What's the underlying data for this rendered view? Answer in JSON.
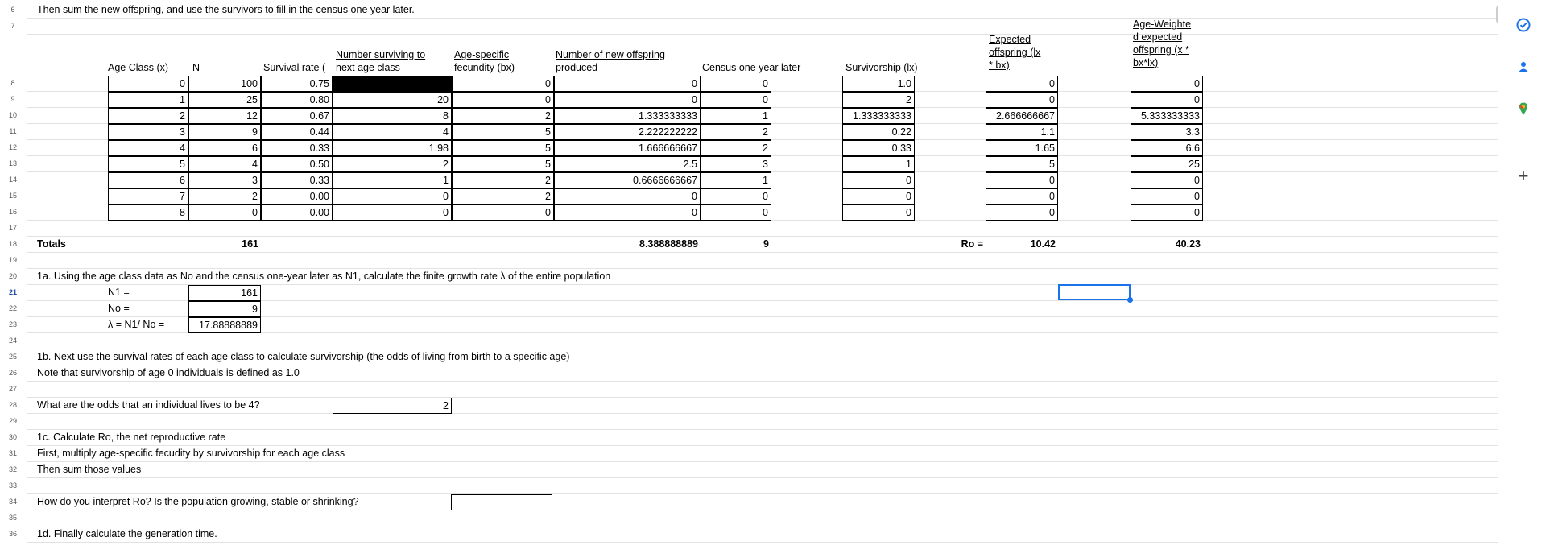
{
  "row_numbers": [
    "6",
    "7",
    "8",
    "9",
    "10",
    "11",
    "12",
    "13",
    "14",
    "15",
    "16",
    "17",
    "18",
    "19",
    "20",
    "21",
    "22",
    "23",
    "24",
    "25",
    "26",
    "27",
    "28",
    "29",
    "30",
    "31",
    "32",
    "33",
    "34",
    "35",
    "36"
  ],
  "selected_row": "21",
  "intro_text": "Then sum the new offspring, and use the survivors to fill in the census one year later.",
  "headers": {
    "age_class": "Age Class (x)",
    "n": "N",
    "survival_rate": "Survival rate (",
    "number_surviving": "Number surviving to\nnext age class",
    "fecundity": "Age-specific\nfecundity (bx)",
    "new_offspring": "Number of new offspring\nproduced",
    "census": "Census one year later",
    "survivorship": "Survivorship (lx)",
    "expected_offspring": "Expected\noffspring (lx\n* bx)",
    "age_weighted": "Age-Weighte\nd expected\noffspring (x *\nbx*lx)"
  },
  "table_rows": [
    {
      "age": "0",
      "n": "100",
      "survival": "0.75",
      "surviving": "",
      "fecundity": "0",
      "offspring": "0",
      "census": "0",
      "lx": "1.0",
      "exp": "0",
      "aw": "0"
    },
    {
      "age": "1",
      "n": "25",
      "survival": "0.80",
      "surviving": "20",
      "fecundity": "0",
      "offspring": "0",
      "census": "0",
      "lx": "2",
      "exp": "0",
      "aw": "0"
    },
    {
      "age": "2",
      "n": "12",
      "survival": "0.67",
      "surviving": "8",
      "fecundity": "2",
      "offspring": "1.333333333",
      "census": "1",
      "lx": "1.333333333",
      "exp": "2.666666667",
      "aw": "5.333333333"
    },
    {
      "age": "3",
      "n": "9",
      "survival": "0.44",
      "surviving": "4",
      "fecundity": "5",
      "offspring": "2.222222222",
      "census": "2",
      "lx": "0.22",
      "exp": "1.1",
      "aw": "3.3"
    },
    {
      "age": "4",
      "n": "6",
      "survival": "0.33",
      "surviving": "1.98",
      "fecundity": "5",
      "offspring": "1.666666667",
      "census": "2",
      "lx": "0.33",
      "exp": "1.65",
      "aw": "6.6"
    },
    {
      "age": "5",
      "n": "4",
      "survival": "0.50",
      "surviving": "2",
      "fecundity": "5",
      "offspring": "2.5",
      "census": "3",
      "lx": "1",
      "exp": "5",
      "aw": "25"
    },
    {
      "age": "6",
      "n": "3",
      "survival": "0.33",
      "surviving": "1",
      "fecundity": "2",
      "offspring": "0.6666666667",
      "census": "1",
      "lx": "0",
      "exp": "0",
      "aw": "0"
    },
    {
      "age": "7",
      "n": "2",
      "survival": "0.00",
      "surviving": "0",
      "fecundity": "2",
      "offspring": "0",
      "census": "0",
      "lx": "0",
      "exp": "0",
      "aw": "0"
    },
    {
      "age": "8",
      "n": "0",
      "survival": "0.00",
      "surviving": "0",
      "fecundity": "0",
      "offspring": "0",
      "census": "0",
      "lx": "0",
      "exp": "0",
      "aw": "0"
    }
  ],
  "totals": {
    "label": "Totals",
    "n": "161",
    "offspring": "8.388888889",
    "census": "9",
    "ro_label": "Ro =",
    "ro_value": "10.42",
    "aw": "40.23"
  },
  "q1a": {
    "text": "1a. Using the age class data as No and the census one-year later as N1, calculate the finite growth rate λ of the entire population",
    "n1_label": "N1 =",
    "n1_value": "161",
    "no_label": "No =",
    "no_value": "9",
    "lambda_label": "λ = N1/ No =",
    "lambda_value": "17.88888889"
  },
  "q1b": {
    "text": "1b. Next use the survival rates of each age class to calculate survivorship (the odds of living from birth to  a specific age)",
    "note": "Note that survivorship of age 0 individuals is defined as 1.0",
    "question": "What are the odds that an individual lives to be 4?",
    "answer": "2"
  },
  "q1c": {
    "text": "1c. Calculate Ro, the net reproductive rate",
    "line2": "First, multiply age-specific fecudity by survivorship for each age class",
    "line3": "Then sum those values",
    "question": "How do you interpret Ro? Is the population growing, stable or shrinking?"
  },
  "q1d": {
    "text": "1d. Finally calculate the generation time."
  },
  "side_icons": [
    "tasks-icon",
    "contacts-icon",
    "maps-icon",
    "add-icon"
  ]
}
